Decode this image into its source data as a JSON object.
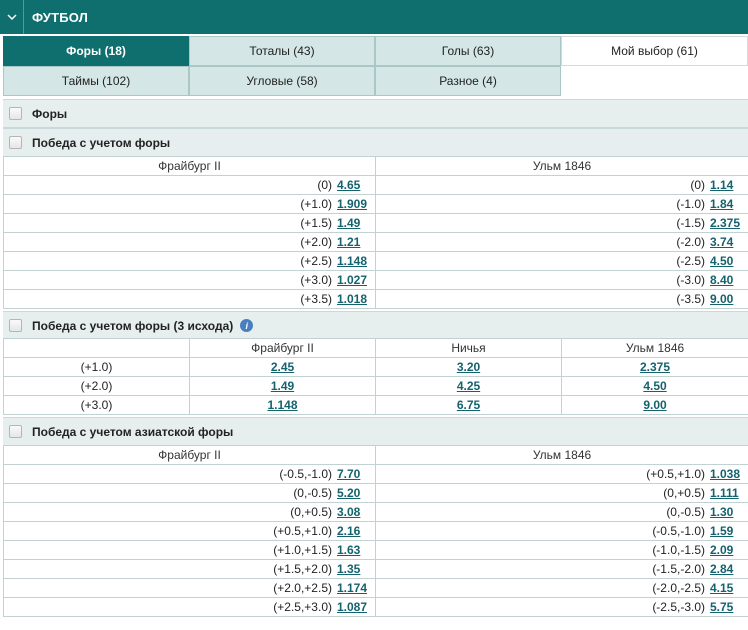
{
  "header": {
    "title": "ФУТБОЛ"
  },
  "tabs": [
    {
      "label": "Форы (18)",
      "active": true
    },
    {
      "label": "Тоталы (43)"
    },
    {
      "label": "Голы (63)"
    },
    {
      "label": "Мой выбор (61)"
    },
    {
      "label": "Таймы (102)"
    },
    {
      "label": "Угловые (58)"
    },
    {
      "label": "Разное (4)"
    }
  ],
  "sections": {
    "fory": {
      "title": "Форы"
    },
    "handicap": {
      "title": "Победа с учетом форы",
      "home": "Фрайбург II",
      "away": "Ульм 1846",
      "rows": [
        {
          "h_hc": "(0)",
          "h_odd": "4.65",
          "a_hc": "(0)",
          "a_odd": "1.14"
        },
        {
          "h_hc": "(+1.0)",
          "h_odd": "1.909",
          "a_hc": "(-1.0)",
          "a_odd": "1.84"
        },
        {
          "h_hc": "(+1.5)",
          "h_odd": "1.49",
          "a_hc": "(-1.5)",
          "a_odd": "2.375"
        },
        {
          "h_hc": "(+2.0)",
          "h_odd": "1.21",
          "a_hc": "(-2.0)",
          "a_odd": "3.74"
        },
        {
          "h_hc": "(+2.5)",
          "h_odd": "1.148",
          "a_hc": "(-2.5)",
          "a_odd": "4.50"
        },
        {
          "h_hc": "(+3.0)",
          "h_odd": "1.027",
          "a_hc": "(-3.0)",
          "a_odd": "8.40"
        },
        {
          "h_hc": "(+3.5)",
          "h_odd": "1.018",
          "a_hc": "(-3.5)",
          "a_odd": "9.00"
        }
      ]
    },
    "handicap3": {
      "title": "Победа с учетом форы (3 исхода)",
      "home": "Фрайбург II",
      "draw": "Ничья",
      "away": "Ульм 1846",
      "rows": [
        {
          "hc": "(+1.0)",
          "home": "2.45",
          "draw": "3.20",
          "away": "2.375"
        },
        {
          "hc": "(+2.0)",
          "home": "1.49",
          "draw": "4.25",
          "away": "4.50"
        },
        {
          "hc": "(+3.0)",
          "home": "1.148",
          "draw": "6.75",
          "away": "9.00"
        }
      ]
    },
    "asian": {
      "title": "Победа с учетом азиатской форы",
      "home": "Фрайбург II",
      "away": "Ульм 1846",
      "rows": [
        {
          "h_hc": "(-0.5,-1.0)",
          "h_odd": "7.70",
          "a_hc": "(+0.5,+1.0)",
          "a_odd": "1.038"
        },
        {
          "h_hc": "(0,-0.5)",
          "h_odd": "5.20",
          "a_hc": "(0,+0.5)",
          "a_odd": "1.111"
        },
        {
          "h_hc": "(0,+0.5)",
          "h_odd": "3.08",
          "a_hc": "(0,-0.5)",
          "a_odd": "1.30"
        },
        {
          "h_hc": "(+0.5,+1.0)",
          "h_odd": "2.16",
          "a_hc": "(-0.5,-1.0)",
          "a_odd": "1.59"
        },
        {
          "h_hc": "(+1.0,+1.5)",
          "h_odd": "1.63",
          "a_hc": "(-1.0,-1.5)",
          "a_odd": "2.09"
        },
        {
          "h_hc": "(+1.5,+2.0)",
          "h_odd": "1.35",
          "a_hc": "(-1.5,-2.0)",
          "a_odd": "2.84"
        },
        {
          "h_hc": "(+2.0,+2.5)",
          "h_odd": "1.174",
          "a_hc": "(-2.0,-2.5)",
          "a_odd": "4.15"
        },
        {
          "h_hc": "(+2.5,+3.0)",
          "h_odd": "1.087",
          "a_hc": "(-2.5,-3.0)",
          "a_odd": "5.75"
        }
      ]
    }
  }
}
